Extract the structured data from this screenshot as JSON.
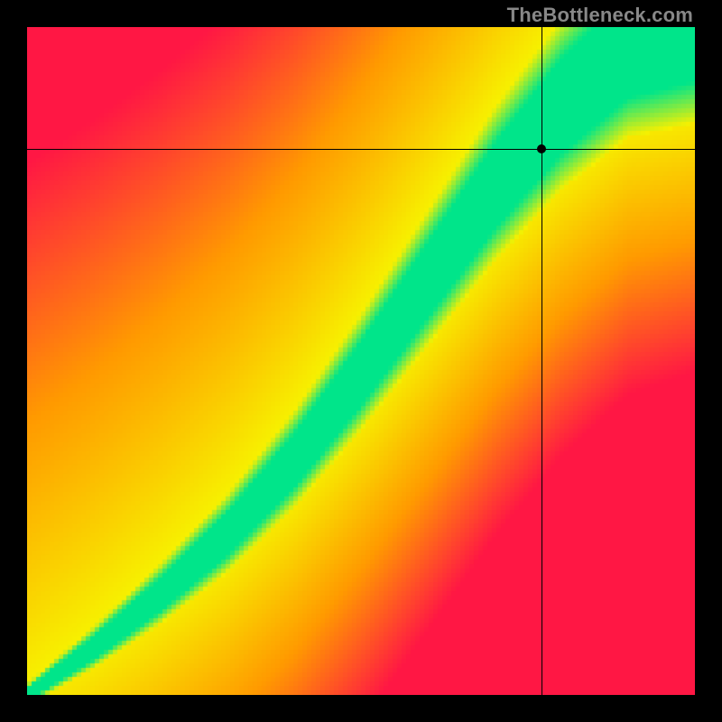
{
  "watermark": "TheBottleneck.com",
  "chart_data": {
    "type": "heatmap",
    "title": "",
    "xlabel": "",
    "ylabel": "",
    "xlim": [
      0,
      1
    ],
    "ylim": [
      0,
      1
    ],
    "crosshair": {
      "x": 0.77,
      "y": 0.817
    },
    "point": {
      "x": 0.77,
      "y": 0.817
    },
    "optimal_curve": [
      {
        "x": 0.0,
        "y": 0.0
      },
      {
        "x": 0.1,
        "y": 0.07
      },
      {
        "x": 0.2,
        "y": 0.15
      },
      {
        "x": 0.3,
        "y": 0.24
      },
      {
        "x": 0.4,
        "y": 0.35
      },
      {
        "x": 0.5,
        "y": 0.48
      },
      {
        "x": 0.6,
        "y": 0.62
      },
      {
        "x": 0.7,
        "y": 0.76
      },
      {
        "x": 0.8,
        "y": 0.88
      },
      {
        "x": 0.9,
        "y": 0.97
      },
      {
        "x": 1.0,
        "y": 1.0
      }
    ],
    "colors": {
      "optimal": "#00e58a",
      "near": "#f7f000",
      "warm": "#ff9a00",
      "bad": "#ff1744"
    },
    "grid": false,
    "legend": null,
    "description": "2D bottleneck heatmap. Green diagonal band = balanced hardware pairing; red corners = severe bottleneck. Black crosshair & dot mark the selected CPU/GPU coordinate."
  }
}
